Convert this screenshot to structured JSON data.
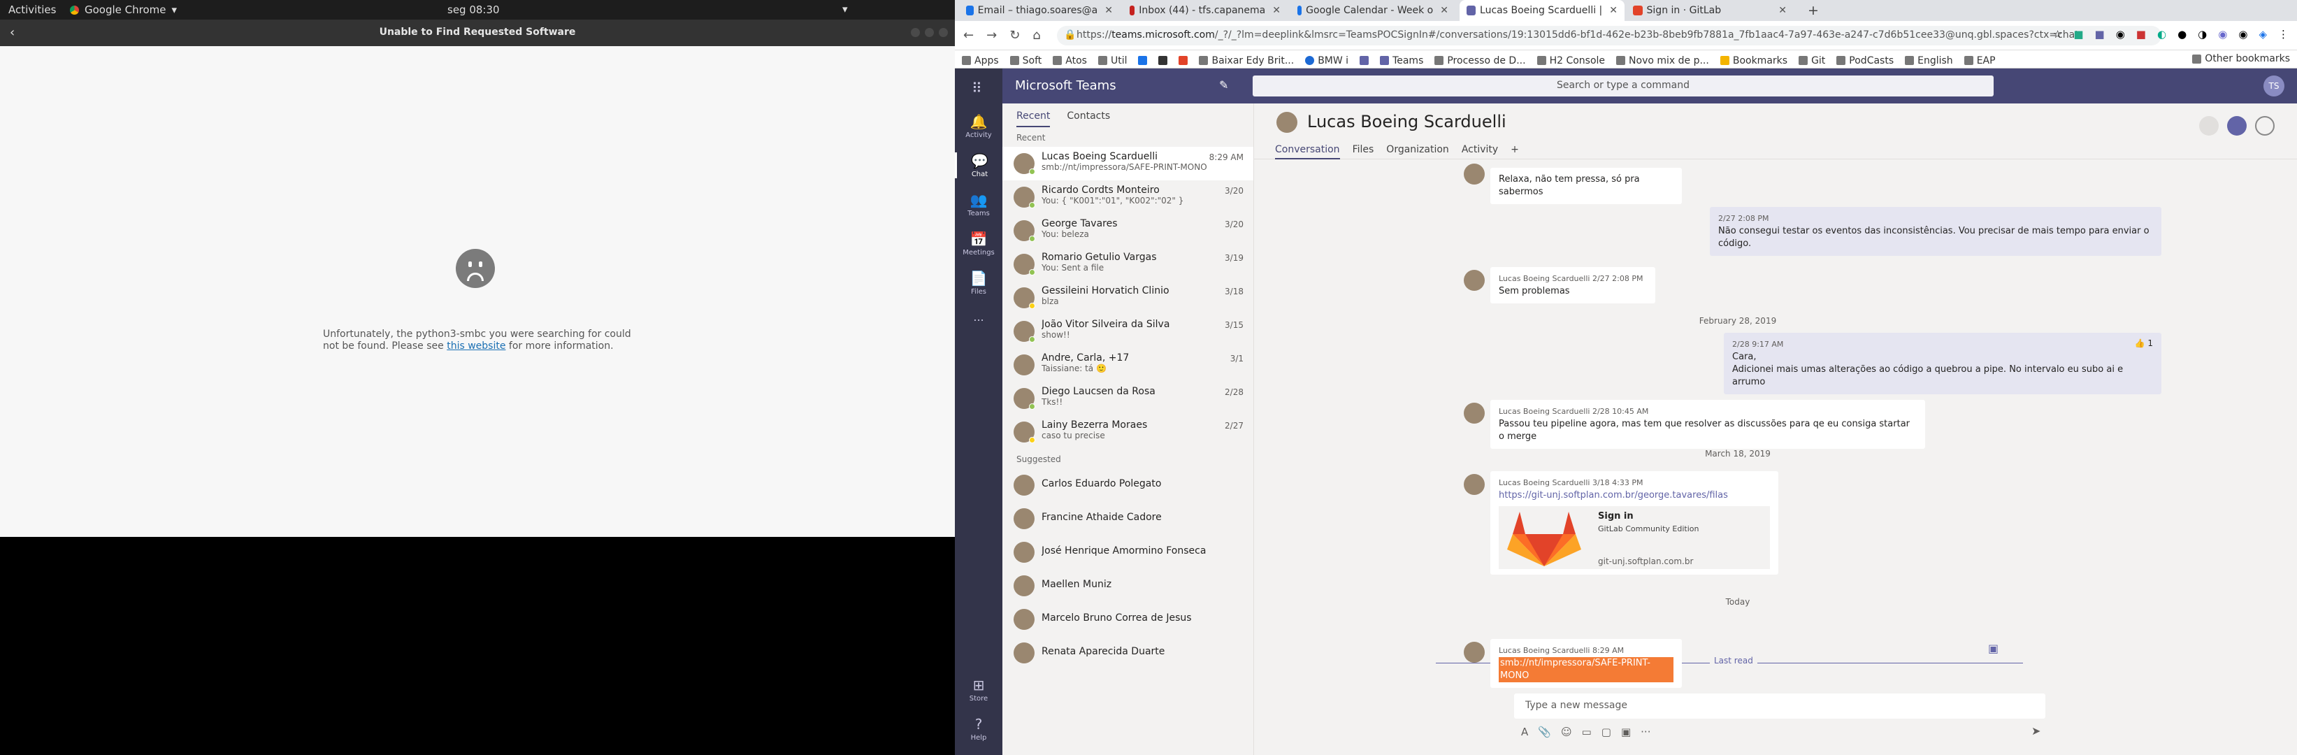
{
  "topbar": {
    "activities": "Activities",
    "app": "Google Chrome",
    "clock": "seg 08:30"
  },
  "left_window": {
    "title": "Unable to Find Requested Software",
    "message_pre": "Unfortunately, the python3-smbc you were searching for could not be found. Please see ",
    "link": "this website",
    "message_post": " for more information."
  },
  "browser": {
    "tabs": [
      {
        "label": "Email – thiago.soares@a",
        "color": "#1a73e8"
      },
      {
        "label": "Inbox (44) - tfs.capanema",
        "color": "#c5221f"
      },
      {
        "label": "Google Calendar - Week o",
        "color": "#1a73e8"
      },
      {
        "label": "Lucas Boeing Scarduelli |",
        "color": "#6264a7"
      },
      {
        "label": "Sign in · GitLab",
        "color": "#e24329"
      }
    ],
    "url_prefix": "https://",
    "url_host": "teams.microsoft.com",
    "url_rest": "/_?/_?lm=deeplink&lmsrc=TeamsPOCSignIn#/conversations/19:13015dd6-bf1d-462e-b23b-8beb9fb7881a_7fb1aac4-7a97-463e-a247-c7d6b51cee33@unq.gbl.spaces?ctx=chat",
    "bookmarks": [
      "Apps",
      "Soft",
      "Atos",
      "Util",
      "",
      "",
      "",
      "Baixar Edy Brit...",
      "BMW i",
      "",
      "Teams",
      "Processo de D...",
      "H2 Console",
      "Novo mix de p...",
      "Bookmarks",
      "Git",
      "PodCasts",
      "English",
      "EAP"
    ],
    "other_bookmarks": "Other bookmarks"
  },
  "teams": {
    "app_name": "Microsoft Teams",
    "search_placeholder": "Search or type a command",
    "user_initials": "TS",
    "rail": [
      "Activity",
      "Chat",
      "Teams",
      "Meetings",
      "Files",
      "...",
      "Store",
      "Help"
    ],
    "list_tabs": [
      "Recent",
      "Contacts"
    ],
    "recent_label": "Recent",
    "suggested_label": "Suggested",
    "chats": [
      {
        "name": "Lucas Boeing Scarduelli",
        "preview": "smb://nt/impressora/SAFE-PRINT-MONO",
        "date": "8:29 AM",
        "status": "#92c353"
      },
      {
        "name": "Ricardo Cordts Monteiro",
        "preview": "You: { \"K001\":\"01\", \"K002\":\"02\" }",
        "date": "3/20",
        "status": "#92c353"
      },
      {
        "name": "George Tavares",
        "preview": "You: beleza",
        "date": "3/20",
        "status": "#92c353"
      },
      {
        "name": "Romario Getulio Vargas",
        "preview": "You: Sent a file",
        "date": "3/19",
        "status": "#92c353"
      },
      {
        "name": "Gessileini Horvatich Clinio",
        "preview": "blza",
        "date": "3/18",
        "status": "#fcd116"
      },
      {
        "name": "João Vitor Silveira da Silva",
        "preview": "show!!",
        "date": "3/15",
        "status": "#92c353"
      },
      {
        "name": "Andre, Carla, +17",
        "preview": "Taissiane: tá 🙂",
        "date": "3/1",
        "status": ""
      },
      {
        "name": "Diego Laucsen da Rosa",
        "preview": "Tks!!",
        "date": "2/28",
        "status": "#92c353"
      },
      {
        "name": "Lainy Bezerra Moraes",
        "preview": "caso tu precise",
        "date": "2/27",
        "status": "#fcd116"
      }
    ],
    "suggested": [
      "Carlos Eduardo Polegato",
      "Francine Athaide Cadore",
      "José Henrique Amormino Fonseca",
      "Maellen Muniz",
      "Marcelo Bruno Correa de Jesus",
      "Renata Aparecida Duarte"
    ],
    "conversation": {
      "title": "Lucas Boeing Scarduelli",
      "tabs": [
        "Conversation",
        "Files",
        "Organization",
        "Activity",
        "+"
      ],
      "messages": [
        {
          "text": "Relaxa, não tem pressa, só pra sabermos"
        },
        {
          "meta": "2/27 2:08 PM",
          "text": "Não consegui testar os eventos das inconsistências. Vou precisar de mais tempo para enviar o código."
        },
        {
          "meta": "Lucas Boeing Scarduelli  2/27 2:08 PM",
          "text": "Sem problemas"
        },
        {
          "meta": "2/28 9:17 AM",
          "text": "Cara,\nAdicionei mais umas alterações ao código a quebrou a pipe. No intervalo eu subo ai e arrumo",
          "reaction": "👍 1"
        },
        {
          "meta": "Lucas Boeing Scarduelli  2/28 10:45 AM",
          "text": "Passou teu pipeline agora, mas tem que resolver as discussões para qe eu consiga startar o merge"
        },
        {
          "meta": "Lucas Boeing Scarduelli  3/18 4:33 PM",
          "link": "https://git-unj.softplan.com.br/george.tavares/filas",
          "card_title": "Sign in",
          "card_sub": "GitLab Community Edition",
          "card_host": "git-unj.softplan.com.br"
        },
        {
          "meta": "Lucas Boeing Scarduelli  8:29 AM",
          "text": "smb://nt/impressora/SAFE-PRINT-MONO"
        }
      ],
      "separators": [
        "February 28, 2019",
        "March 18, 2019",
        "Today"
      ],
      "last_read": "Last read",
      "compose_placeholder": "Type a new message"
    }
  }
}
